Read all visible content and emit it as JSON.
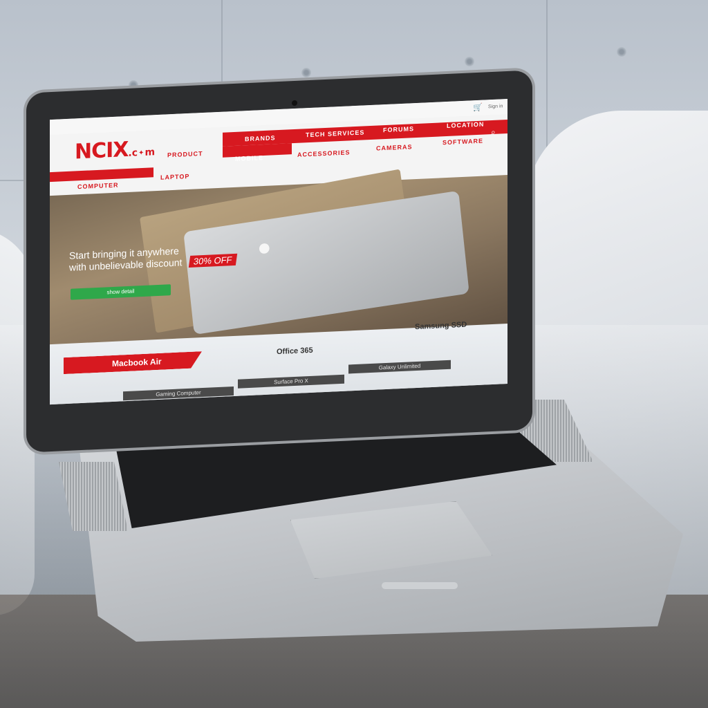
{
  "site": {
    "logo": {
      "main": "NCIX",
      "suffix": ".c",
      "suffix2": "m"
    },
    "topbar": {
      "signin": "Sign in",
      "cart_icon": "cart-icon"
    },
    "nav_row1": [
      "BRANDS",
      "TECH SERVICES",
      "FORUMS",
      "LOCATION"
    ],
    "nav_row2": [
      "PRODUCT",
      "MOBILE",
      "ACCESSORIES",
      "CAMERAS",
      "SOFTWARE"
    ],
    "nav_row3": [
      "COMPUTER",
      "LAPTOP"
    ],
    "hero": {
      "line1": "Start bringing it anywhere",
      "line2": "with unbelievable discount",
      "badge": "30% OFF",
      "button": "show detail"
    },
    "products": {
      "featured": "Macbook Air",
      "labels": [
        "Office 365",
        "Samsung SSD"
      ],
      "tiles": [
        "Gaming Computer",
        "Surface Pro X",
        "Galaxy Unlimited"
      ]
    }
  },
  "colors": {
    "brand_red": "#d71920",
    "button_green": "#2fa84a"
  }
}
